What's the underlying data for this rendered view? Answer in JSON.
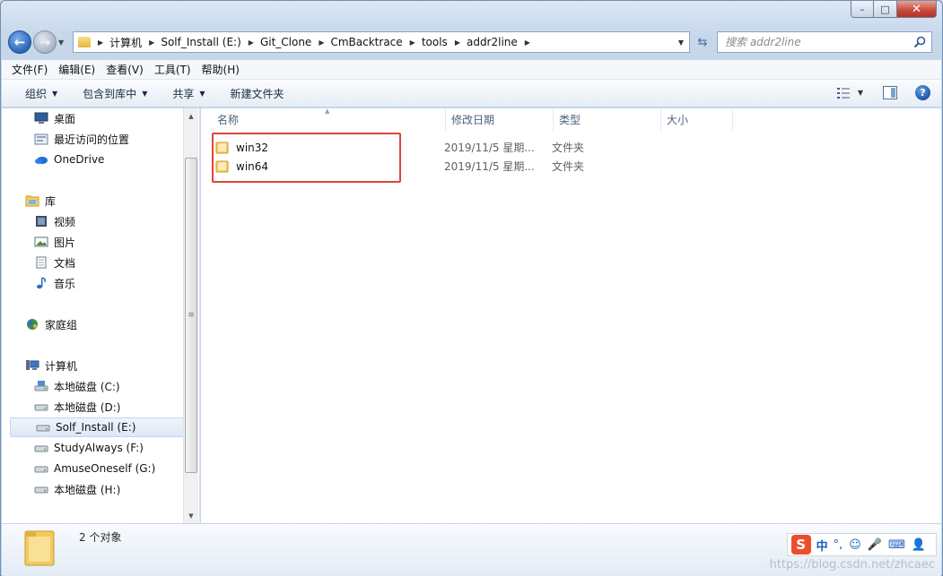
{
  "window": {
    "min_label": "–",
    "max_label": "□",
    "close_label": "✕"
  },
  "address": {
    "crumbs": [
      "计算机",
      "Solf_Install (E:)",
      "Git_Clone",
      "CmBacktrace",
      "tools",
      "addr2line"
    ],
    "search_placeholder": "搜索 addr2line"
  },
  "menu": [
    "文件(F)",
    "编辑(E)",
    "查看(V)",
    "工具(T)",
    "帮助(H)"
  ],
  "toolbar": {
    "organize": "组织",
    "include_library": "包含到库中",
    "share": "共享",
    "new_folder": "新建文件夹"
  },
  "nav": {
    "favorites": [
      {
        "label": "桌面",
        "icon": "desktop-icon"
      },
      {
        "label": "最近访问的位置",
        "icon": "recent-places-icon"
      },
      {
        "label": "OneDrive",
        "icon": "onedrive-icon"
      }
    ],
    "library_header": "库",
    "libraries": [
      {
        "label": "视频",
        "icon": "video-icon"
      },
      {
        "label": "图片",
        "icon": "pictures-icon"
      },
      {
        "label": "文档",
        "icon": "documents-icon"
      },
      {
        "label": "音乐",
        "icon": "music-icon"
      }
    ],
    "homegroup": "家庭组",
    "computer_header": "计算机",
    "drives": [
      {
        "label": "本地磁盘 (C:)",
        "icon": "system-drive-icon"
      },
      {
        "label": "本地磁盘 (D:)",
        "icon": "drive-icon"
      },
      {
        "label": "Solf_Install (E:)",
        "icon": "drive-icon",
        "selected": true
      },
      {
        "label": "StudyAlways (F:)",
        "icon": "drive-icon"
      },
      {
        "label": "AmuseOneself (G:)",
        "icon": "drive-icon"
      },
      {
        "label": "本地磁盘 (H:)",
        "icon": "drive-icon"
      }
    ]
  },
  "columns": {
    "name": "名称",
    "date": "修改日期",
    "type": "类型",
    "size": "大小"
  },
  "files": [
    {
      "name": "win32",
      "date": "2019/11/5 星期...",
      "type": "文件夹"
    },
    {
      "name": "win64",
      "date": "2019/11/5 星期...",
      "type": "文件夹"
    }
  ],
  "status": {
    "count": "2 个对象"
  },
  "ime": {
    "logo": "S",
    "lang": "中",
    "punct": "°,"
  },
  "watermark": "https://blog.csdn.net/zhcaec",
  "colors": {
    "highlight": "#e0443a",
    "accent": "#2a66b8"
  }
}
